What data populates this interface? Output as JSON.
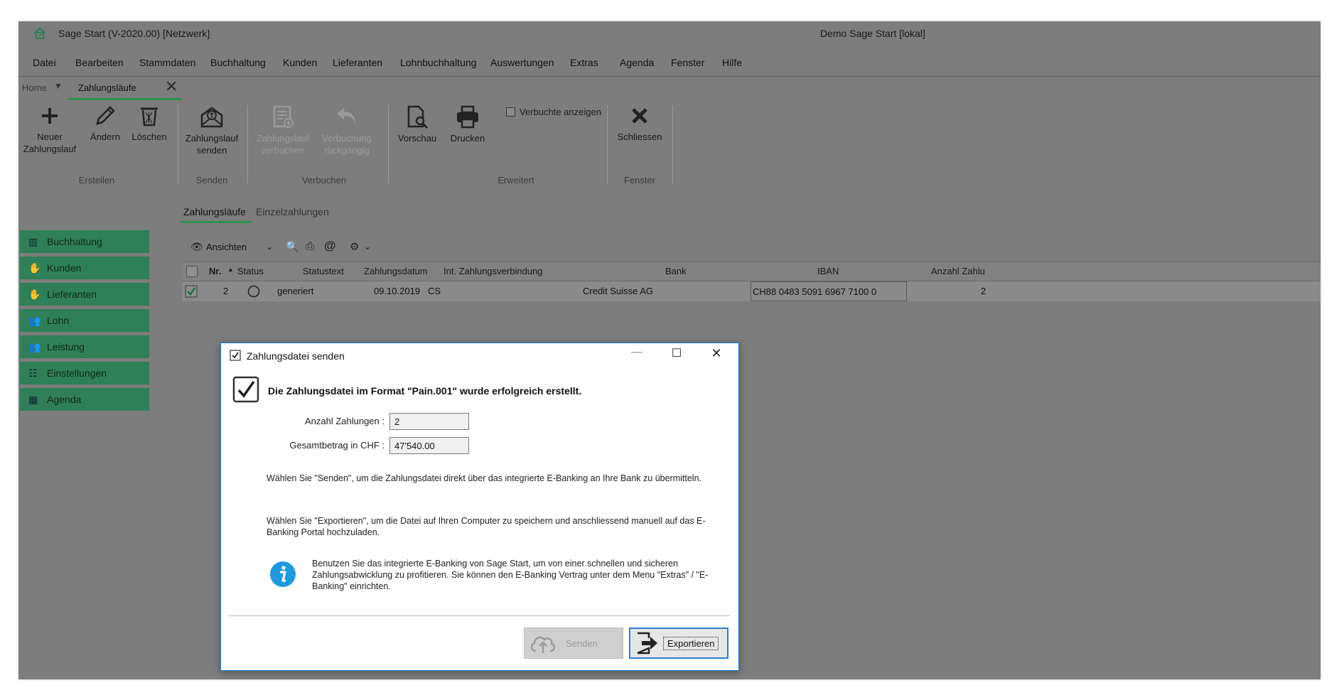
{
  "window": {
    "title": "Sage Start (V-2020.00) [Netzwerk]",
    "center_title": "Demo Sage Start [lokal]"
  },
  "menu": [
    "Datei",
    "Bearbeiten",
    "Stammdaten",
    "Buchhaltung",
    "Kunden",
    "Lieferanten",
    "Lohnbuchhaltung",
    "Auswertungen",
    "Extras",
    "Agenda",
    "Fenster",
    "Hilfe"
  ],
  "tabs": {
    "home": "Home",
    "active": "Zahlungsläufe"
  },
  "ribbon": {
    "neuer_line1": "Neuer",
    "neuer_line2": "Zahlungslauf",
    "aendern": "Ändern",
    "loeschen": "Löschen",
    "senden_line1": "Zahlungslauf",
    "senden_line2": "senden",
    "verbuchen_line1": "Zahlungslauf",
    "verbuchen_line2": "verbuchen",
    "rueck_line1": "Verbuchung",
    "rueck_line2": "rückgängig",
    "vorschau": "Vorschau",
    "drucken": "Drucken",
    "verbuchte_anzeigen": "Verbuchte anzeigen",
    "schliessen": "Schliessen",
    "groups": {
      "erstellen": "Erstellen",
      "senden": "Senden",
      "verbuchen": "Verbuchen",
      "erweitert": "Erweitert",
      "fenster": "Fenster"
    }
  },
  "sidebar": [
    {
      "label": "Buchhaltung",
      "icon": "book-icon"
    },
    {
      "label": "Kunden",
      "icon": "handshake-icon"
    },
    {
      "label": "Lieferanten",
      "icon": "handshake-icon"
    },
    {
      "label": "Lohn",
      "icon": "users-icon"
    },
    {
      "label": "Leistung",
      "icon": "users-icon"
    },
    {
      "label": "Einstellungen",
      "icon": "clipboard-icon"
    },
    {
      "label": "Agenda",
      "icon": "calendar-icon"
    }
  ],
  "content_tabs": {
    "zahlungslaeufe": "Zahlungsläufe",
    "einzelzahlungen": "Einzelzahlungen"
  },
  "grid": {
    "toolbar_ansichten": "Ansichten",
    "headers": {
      "nr": "Nr.",
      "status": "Status",
      "statustext": "Statustext",
      "zahlungsdatum": "Zahlungsdatum",
      "verbindung": "Int. Zahlungsverbindung",
      "bank": "Bank",
      "iban": "IBAN",
      "anzahl": "Anzahl Zahlu"
    },
    "row": {
      "nr": "2",
      "statustext": "generiert",
      "zahlungsdatum": "09.10.2019",
      "verbindung": "CS",
      "bank": "Credit Suisse AG",
      "iban": "CH88 0483 5091 6967 7100 0",
      "anzahl": "2"
    }
  },
  "dialog": {
    "title": "Zahlungsdatei senden",
    "heading": "Die Zahlungsdatei im Format \"Pain.001\" wurde erfolgreich erstellt.",
    "anzahl_label": "Anzahl Zahlungen :",
    "anzahl_value": "2",
    "gesamt_label": "Gesamtbetrag in CHF :",
    "gesamt_value": "47'540.00",
    "para1": "Wählen Sie \"Senden\", um die Zahlungsdatei direkt über das integrierte E-Banking an Ihre Bank zu übermitteln.",
    "para2": "Wählen Sie \"Exportieren\", um die Datei auf Ihren Computer zu speichern und anschliessend manuell auf das E-Banking Portal hochzuladen.",
    "info": "Benutzen Sie das integrierte E-Banking von Sage Start, um von einer schnellen und sicheren Zahlungsabwicklung zu profitieren. Sie können den E-Banking Vertrag unter dem Menu \"Extras\" / \"E-Banking\" einrichten.",
    "btn_senden": "Senden",
    "btn_exportieren": "Exportieren"
  },
  "colors": {
    "accent_green": "#2f7f58",
    "dialog_border": "#1e7bd1",
    "info_blue": "#1e9be0"
  }
}
